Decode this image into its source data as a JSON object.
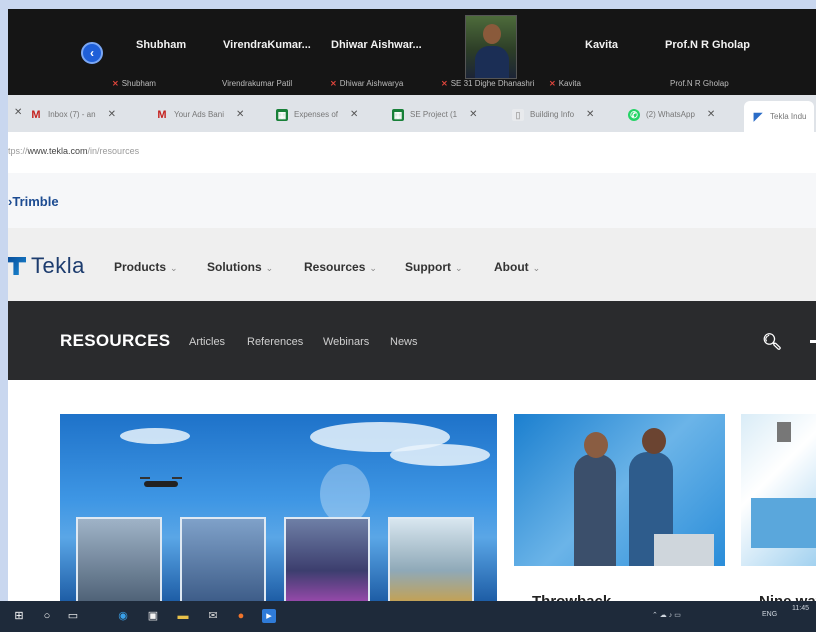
{
  "meeting": {
    "participants": [
      {
        "name": "Shubham",
        "sub": "Shubham"
      },
      {
        "name": "VirendraKumar...",
        "sub": "Virendrakumar Patil"
      },
      {
        "name": "Dhiwar Aishwar...",
        "sub": "Dhiwar Aishwarya"
      },
      {
        "name": "",
        "sub": "SE 31 Dighe Dhanashri"
      },
      {
        "name": "Kavita",
        "sub": "Kavita"
      },
      {
        "name": "Prof.N R Gholap",
        "sub": "Prof.N R Gholap"
      }
    ]
  },
  "browser": {
    "tabs": [
      {
        "label": "Inbox (7) - an",
        "icon": "gmail-icon"
      },
      {
        "label": "Your Ads Bani",
        "icon": "gmail-icon"
      },
      {
        "label": "Expenses of",
        "icon": "sheets-icon"
      },
      {
        "label": "SE Project (1",
        "icon": "sheets-icon"
      },
      {
        "label": "Building Info",
        "icon": "doc-icon"
      },
      {
        "label": "(2) WhatsApp",
        "icon": "whatsapp-icon"
      },
      {
        "label": "Tekla Indu",
        "icon": "tekla-icon"
      }
    ],
    "url_prefix": "tps://",
    "url_host": "www.tekla.com",
    "url_path": "/in/resources"
  },
  "site": {
    "trimble": "Trimble",
    "logo": "Tekla",
    "nav": [
      "Products",
      "Solutions",
      "Resources",
      "Support",
      "About"
    ],
    "section_title": "RESOURCES",
    "section_links": [
      "Articles",
      "References",
      "Webinars",
      "News"
    ],
    "card_titles": [
      "Throwback",
      "Nine ways"
    ]
  },
  "taskbar": {
    "tray_text": "ENG",
    "time": "11:45"
  },
  "colors": {
    "accent": "#1c4b91",
    "resources_bar": "#2a2b2d",
    "taskbar": "#1e2a3a"
  }
}
